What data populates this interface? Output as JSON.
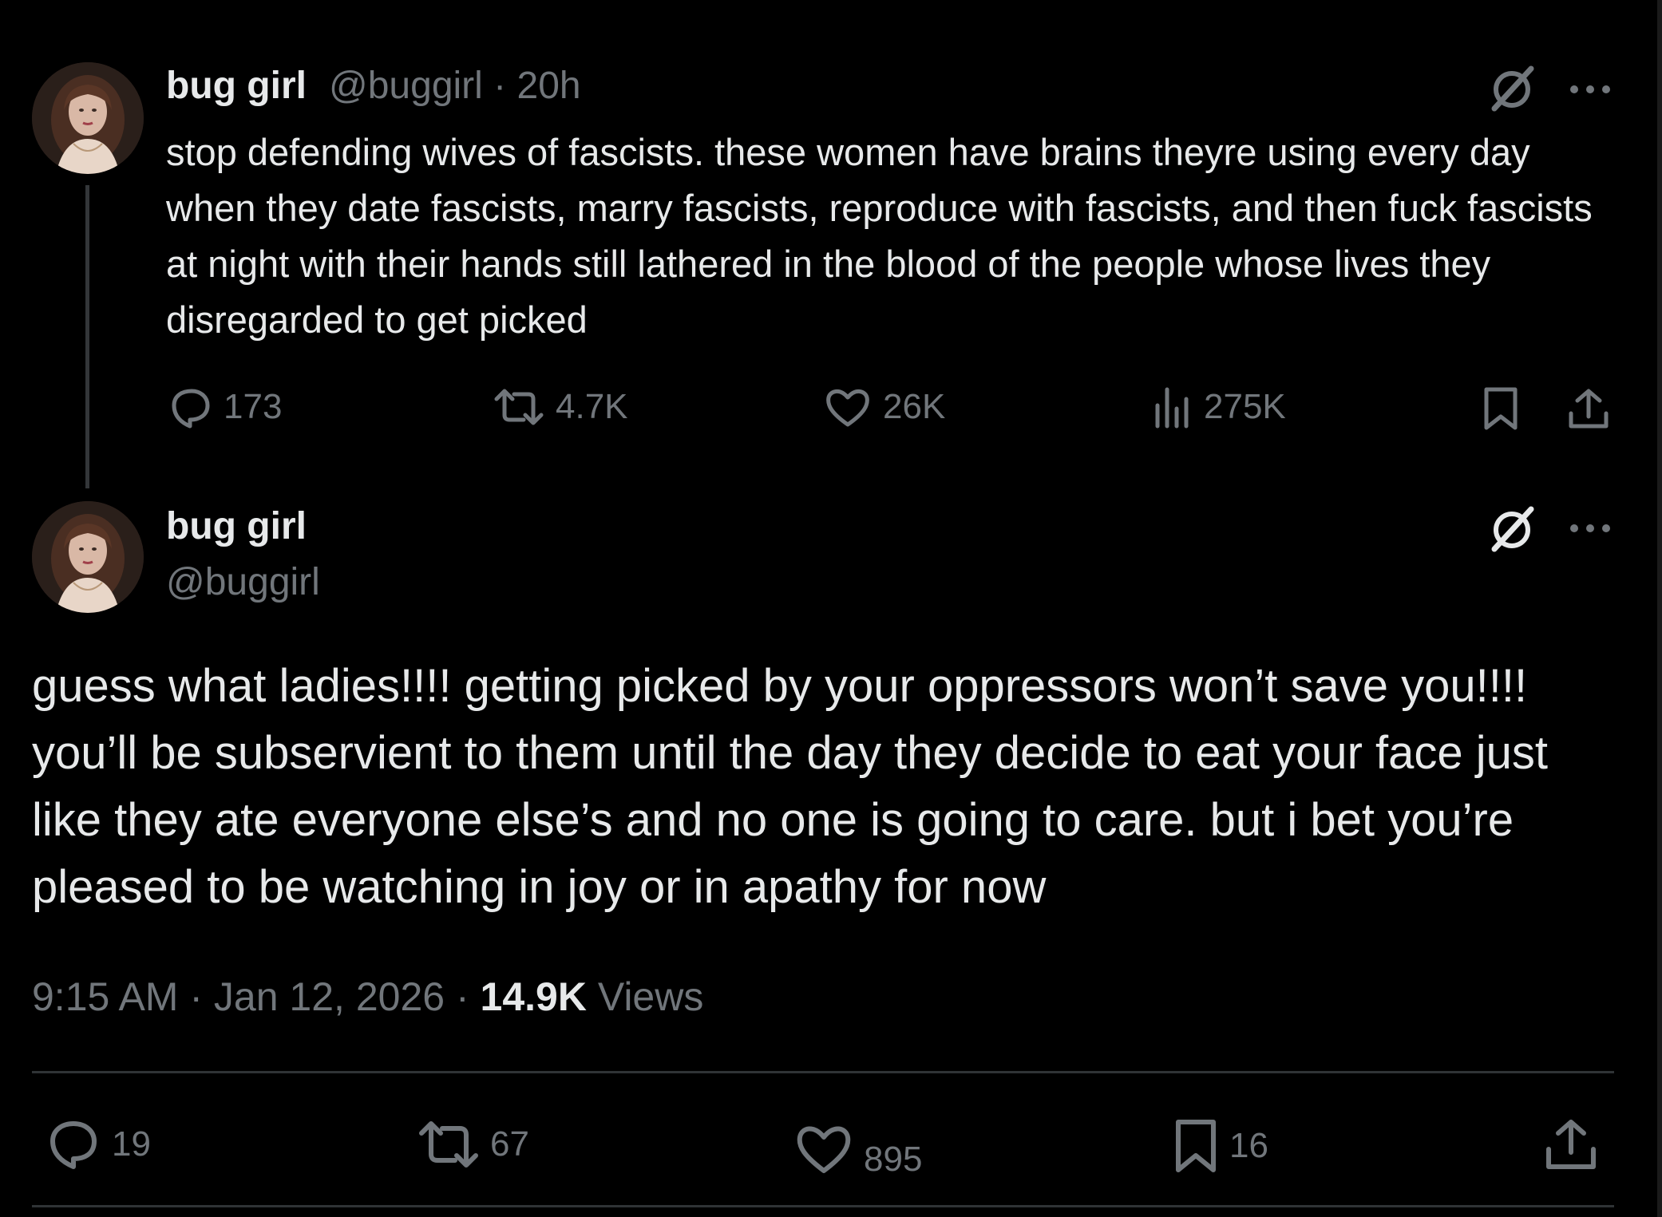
{
  "tweet1": {
    "display_name": "bug girl",
    "handle": "@buggirl",
    "separator": "·",
    "time": "20h",
    "text": "stop defending wives of fascists. these women have brains theyre using every day when they date fascists, marry fascists, reproduce with fascists, and then fuck fascists at night with their hands still lathered in the blood of the people whose lives they disregarded to get picked",
    "replies": "173",
    "reposts": "4.7K",
    "likes": "26K",
    "views": "275K"
  },
  "tweet2": {
    "display_name": "bug girl",
    "handle": "@buggirl",
    "text": "guess what ladies!!!! getting picked by your oppressors won’t save you!!!! you’ll be subservient to them until the day they decide to eat your face just like they ate everyone else’s and no one is going to care. but i bet you’re pleased to be watching in joy or in apathy for now",
    "time": "9:15 AM",
    "date": "Jan 12, 2026",
    "sep1": "·",
    "sep2": "·",
    "views_count": "14.9K",
    "views_label": "Views",
    "replies": "19",
    "reposts": "67",
    "likes": "895",
    "bookmarks": "16"
  },
  "icons": {
    "grok": "grok-icon",
    "more": "more-icon",
    "reply": "reply-icon",
    "repost": "repost-icon",
    "like": "heart-icon",
    "views": "views-icon",
    "bookmark": "bookmark-icon",
    "share": "share-icon"
  },
  "colors": {
    "background": "#000000",
    "text": "#e7e9ea",
    "muted": "#71767b",
    "divider": "#2f3336"
  }
}
